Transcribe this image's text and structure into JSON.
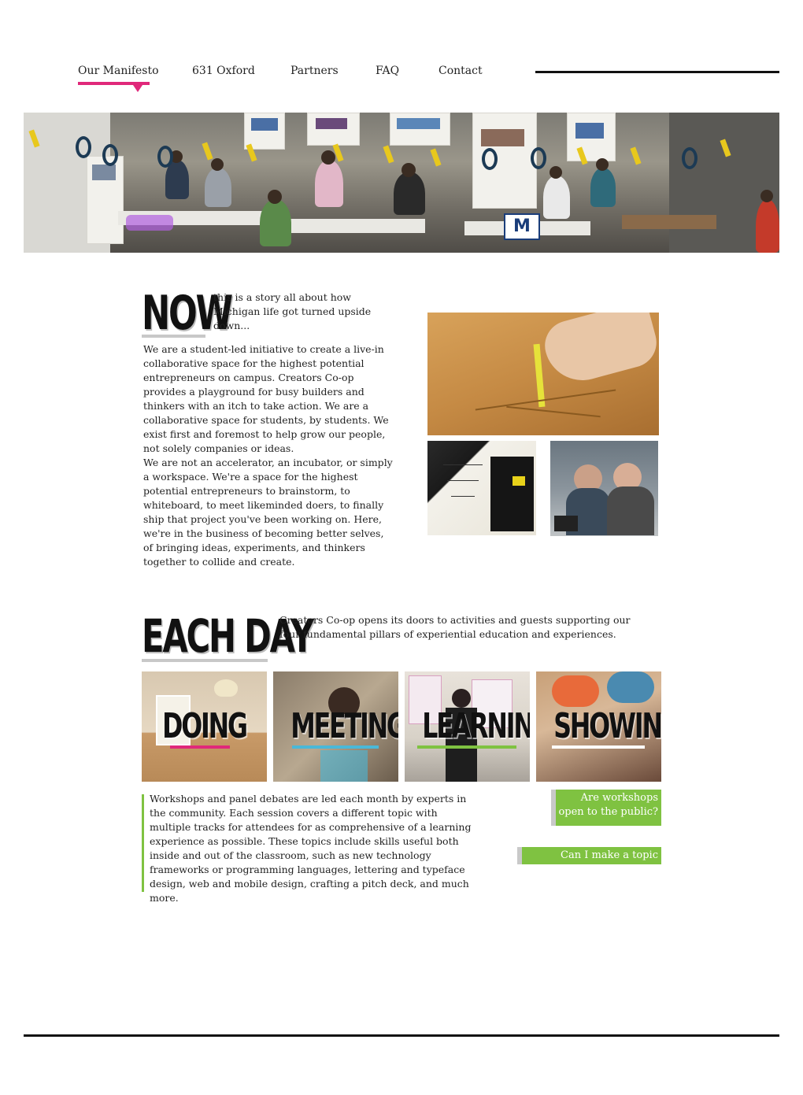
{
  "nav": {
    "items": [
      {
        "label": "Our Manifesto",
        "active": true
      },
      {
        "label": "631 Oxford",
        "active": false
      },
      {
        "label": "Partners",
        "active": false
      },
      {
        "label": "FAQ",
        "active": false
      },
      {
        "label": "Contact",
        "active": false
      }
    ],
    "accent_color": "#e0287a"
  },
  "now_section": {
    "heading": "NOW",
    "tagline": "this is a story all about how Michigan life got turned upside down...",
    "paragraph1": "We are a student-led initiative to create a live-in collaborative space for the highest potential entrepreneurs on campus.  Creators Co-op provides a playground for busy builders and thinkers with an itch to take action.  We are a collaborative space for students, by students.  We exist first and foremost to help grow our people, not solely companies or ideas.",
    "paragraph2": "We are not an accelerator, an incubator, or simply a workspace.  We're a space for the highest potential entrepreneurs to brainstorm, to whiteboard, to meet likeminded doers, to finally ship that project you've been working on.  Here, we're in the business of becoming better selves, of bringing ideas, experiments, and thinkers together to collide and create."
  },
  "each_day_section": {
    "heading": "EACH DAY",
    "intro": "Creators Co-op opens its doors to activities and guests supporting our four fundamental pillars of experiential education and experiences.",
    "pillars": [
      {
        "label": "DOING",
        "color": "#e0287a"
      },
      {
        "label": "MEETING",
        "color": "#4ab8d8"
      },
      {
        "label": "LEARNING",
        "color": "#7fc241"
      },
      {
        "label": "SHOWING",
        "color": "#ffffff"
      }
    ],
    "description": "Workshops and panel debates are led each month by experts in the community.  Each session covers a different topic with multiple tracks for attendees for as comprehensive of a learning experience as possible.  These topics include skills useful both inside and out of the classroom, such as new technology frameworks or programming languages, lettering and typeface design, web and mobile design, crafting a pitch deck, and much more.",
    "questions": [
      {
        "label": "Are workshops open to the public?"
      },
      {
        "label": "Can I make a topic request?"
      }
    ],
    "accent_color": "#7fc241"
  }
}
